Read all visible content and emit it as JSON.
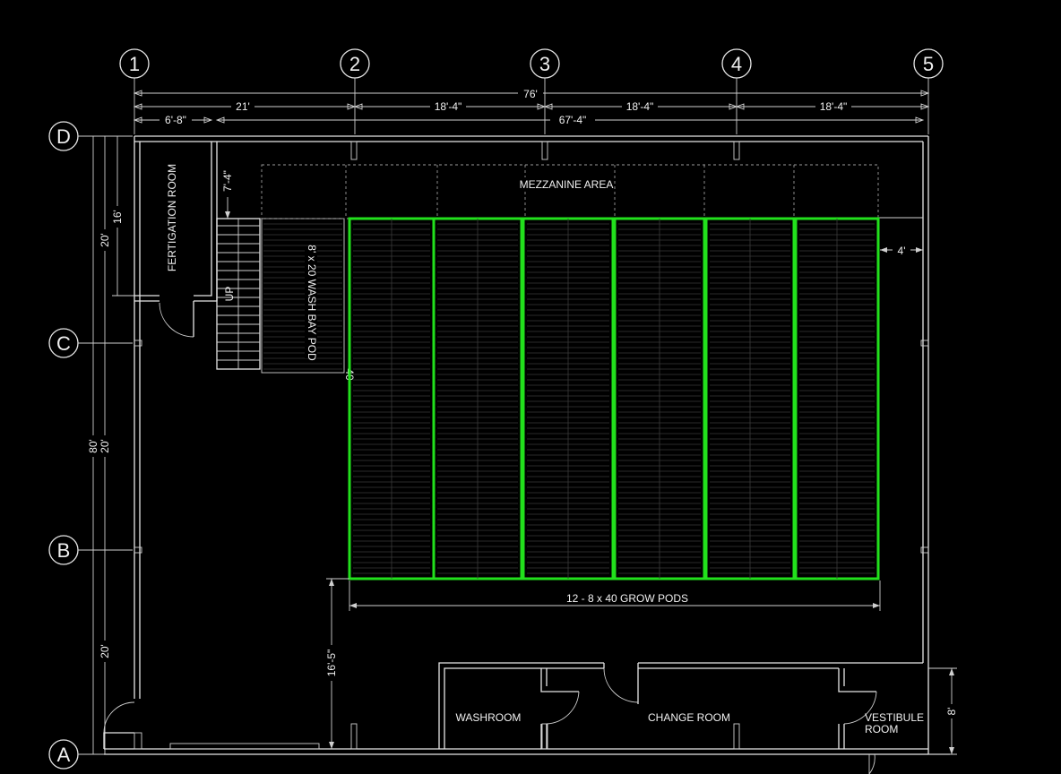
{
  "grid": {
    "columns": [
      "1",
      "2",
      "3",
      "4",
      "5"
    ],
    "rows": [
      "D",
      "C",
      "B",
      "A"
    ]
  },
  "dimensions": {
    "overall": "76'",
    "bay_1_2": "21'",
    "bay_2_3": "18'-4\"",
    "bay_3_4": "18'-4\"",
    "bay_4_5": "18'-4\"",
    "left_room": "6'-8\"",
    "right_span": "67'-4\"",
    "left_20_top": "20'",
    "left_16": "16'",
    "left_80": "80'",
    "left_20_mid": "20'",
    "left_20_bot": "20'",
    "mezz_7_4": "7'-4\"",
    "right_4": "4'",
    "bottom_16_5": "16'-5\"",
    "right_8": "8'",
    "small_40": "40"
  },
  "labels": {
    "mezzanine": "MEZZANINE AREA",
    "grow_pods": "12 - 8 x 40 GROW PODS",
    "fertigation": "FERTIGATION ROOM",
    "wash_bay": "8' x 20 WASH BAY POD",
    "up": "UP",
    "washroom": "WASHROOM",
    "change_room": "CHANGE ROOM",
    "vestibule_1": "VESTIBULE",
    "vestibule_2": "ROOM"
  },
  "colors": {
    "background": "#000000",
    "linework": "#e6e6e6",
    "grow_pod_outline": "#22e01c"
  }
}
